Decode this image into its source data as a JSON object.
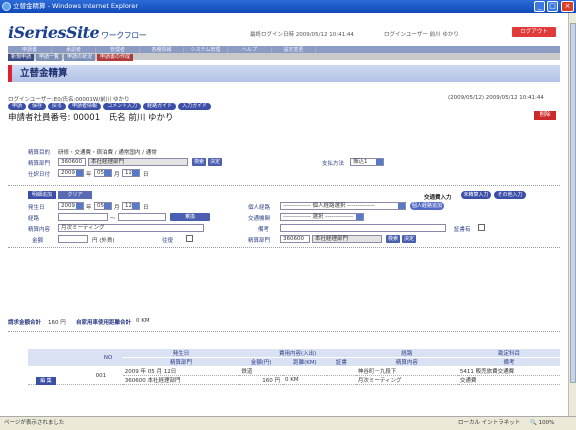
{
  "window": {
    "title": "立替金精算 - Windows Internet Explorer"
  },
  "header": {
    "logo": "iSeriesSite",
    "logo_sub": "ワークフロー",
    "date_label": "最終ログイン日時",
    "date": "2009/05/12 10:41:44",
    "user_label": "ログインユーザー",
    "user": "前川 ゆかり",
    "logout": "ログアウト"
  },
  "nav": [
    "申請書",
    "承認者",
    "管理者",
    "各種情報",
    "システム管理",
    "ヘルプ",
    "設定変更"
  ],
  "subnav": [
    "新規申請",
    "申請一覧",
    "申請の状況",
    "申請書の作成"
  ],
  "page_title": "立替金精算",
  "login_line": "ログインユーザー:E0/氏名:00001W/前川 ゆかり",
  "pub_date": "(2009/05/12) 2009/05/12 10:41:44",
  "action_buttons": [
    "申請",
    "保存",
    "戻る",
    "申請者情報",
    "コメント入力",
    "経路ガイド",
    "入力ガイド"
  ],
  "applicant": {
    "label1": "申請者社員番号:",
    "no": "00001",
    "label2": "氏名",
    "name": "前川 ゆかり"
  },
  "delete": "削除",
  "form": {
    "purpose_label": "精算目的",
    "purpose": "研修・交通費・宿泊費 / 通常国内 / 通常",
    "dept_label": "精算部門",
    "dept_code": "360600",
    "dept_name": "本社経理部門",
    "search": "検索",
    "confirm": "決定",
    "pay_label": "支払方法",
    "pay": "振込1",
    "date_label": "仕訳日付",
    "year": "2009",
    "month": "05",
    "day": "12",
    "y": "年",
    "m": "月",
    "d": "日"
  },
  "detail": {
    "add": "明細追加",
    "clear": "クリア",
    "fare_input": "交通費入力",
    "fare_btn1": "未精算入力",
    "fare_btn2": "その他入力",
    "date_label": "発生日",
    "year": "2009",
    "month": "05",
    "day": "12",
    "personal_label": "個人経路",
    "personal": "-------------- 個人経路選択 --------------",
    "personal_btn": "個人経路追加",
    "route_label": "経路",
    "route_to": "〜",
    "route_btn": "乗換",
    "transport_label": "交通機関",
    "transport": "-------------- 選択 --------------",
    "content_label": "精算内容",
    "content": "月次ミーティング",
    "remarks_label": "備考",
    "receipt_label": "証書有",
    "amount_label": "金額",
    "yen": "円 (外貨)",
    "roundtrip": "往復",
    "dept_label": "精算部門",
    "dept_code": "360600",
    "dept_name": "本社経理部門",
    "search": "検索",
    "confirm": "決定"
  },
  "totals": {
    "label": "請求金額合計",
    "amount": "160 円",
    "car_label": "自家用車使用距離合計",
    "car": "0 KM"
  },
  "table": {
    "headers": {
      "no": "NO",
      "date": "発生日",
      "dept": "精算部門",
      "usage": "費用内容(入出)",
      "amount": "金額(円)",
      "distance": "距離(KM)",
      "receipt": "証書",
      "route": "経路",
      "content": "精算内容",
      "account": "勘定科目",
      "remarks": "備考"
    },
    "rows": [
      {
        "edit": "編 集",
        "no": "001",
        "date": "2009 年 05 月 12日",
        "dept": "360600 本社経理部門",
        "usage": "鉄道",
        "amount": "160 円",
        "distance": "0 KM",
        "route": "神谷町－九段下",
        "content": "月次ミーティング",
        "account": "5411 販売旅費交通費",
        "remarks": "交通費"
      }
    ]
  },
  "status": {
    "left": "ページが表示されました",
    "zone": "ローカル イントラネット",
    "zoom": "100%"
  }
}
